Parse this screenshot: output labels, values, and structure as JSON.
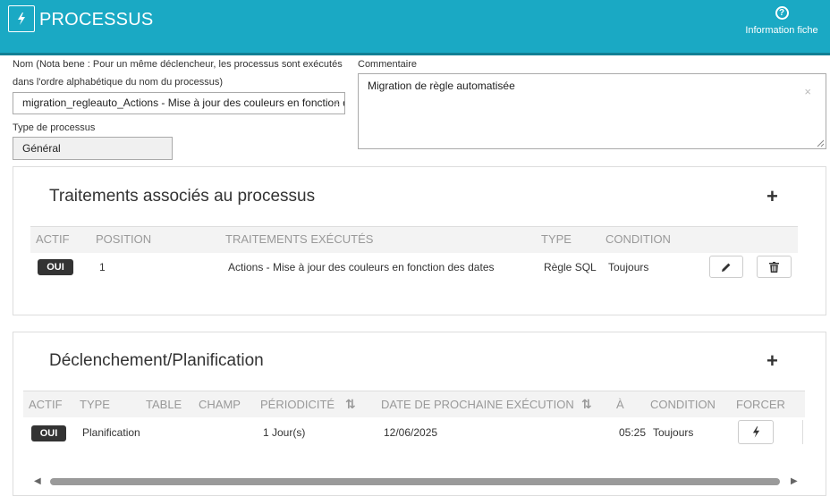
{
  "header": {
    "title": "PROCESSUS",
    "info_label": "Information fiche",
    "info_icon": "question-circle-icon",
    "bolt_icon": "bolt-icon"
  },
  "form": {
    "name_label_line1": "Nom (Nota bene : Pour un même déclencheur, les processus sont exécutés",
    "name_label_line2": "dans l'ordre alphabétique du nom du processus)",
    "name_value": "migration_regleauto_Actions - Mise à jour des couleurs en fonction des dates",
    "type_label": "Type de processus",
    "type_value": "Général",
    "comment_label": "Commentaire",
    "comment_value": "Migration de règle automatisée"
  },
  "traitements": {
    "title": "Traitements associés au processus",
    "columns": [
      "ACTIF",
      "POSITION",
      "TRAITEMENTS EXÉCUTÉS",
      "TYPE",
      "CONDITION"
    ],
    "rows": [
      {
        "actif": "OUI",
        "position": "1",
        "traitement": "Actions - Mise à jour des couleurs en fonction des dates",
        "type": "Règle SQL",
        "condition": "Toujours"
      }
    ]
  },
  "declenchement": {
    "title": "Déclenchement/Planification",
    "columns": [
      "ACTIF",
      "TYPE",
      "TABLE",
      "CHAMP",
      "PÉRIODICITÉ",
      "DATE DE PROCHAINE EXÉCUTION",
      "À",
      "CONDITION",
      "FORCER"
    ],
    "rows": [
      {
        "actif": "OUI",
        "type": "Planification",
        "table": "",
        "champ": "",
        "periodicite": "1 Jour(s)",
        "date": "12/06/2025",
        "heure": "05:25",
        "condition": "Toujours"
      }
    ]
  },
  "colors": {
    "header_bg": "#1aa9c4",
    "badge_bg": "#333333"
  }
}
